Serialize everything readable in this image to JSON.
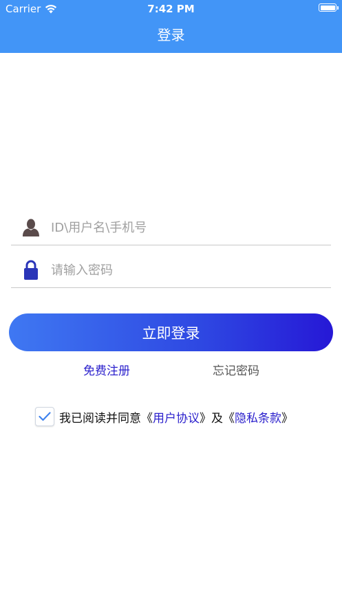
{
  "status_bar": {
    "carrier": "Carrier",
    "time": "7:42 PM",
    "wifi_icon": "wifi-icon",
    "battery_icon": "battery-icon"
  },
  "header": {
    "title": "登录",
    "background_color": "#4295f7"
  },
  "form": {
    "username": {
      "icon": "user-icon",
      "placeholder": "ID\\用户名\\手机号",
      "value": ""
    },
    "password": {
      "icon": "lock-icon",
      "placeholder": "请输入密码",
      "value": ""
    }
  },
  "actions": {
    "login_label": "立即登录",
    "register_label": "免费注册",
    "forgot_label": "忘记密码"
  },
  "agreement": {
    "checked": true,
    "prefix": "我已阅读并同意",
    "open_quote_1": "《",
    "user_agreement": "用户协议",
    "middle": "》及《",
    "privacy_policy": "隐私条款",
    "close_quote": "》"
  },
  "colors": {
    "accent": "#4295f7",
    "link": "#2a1fcc",
    "button_gradient_start": "#3f78f2",
    "button_gradient_end": "#2618d6"
  }
}
